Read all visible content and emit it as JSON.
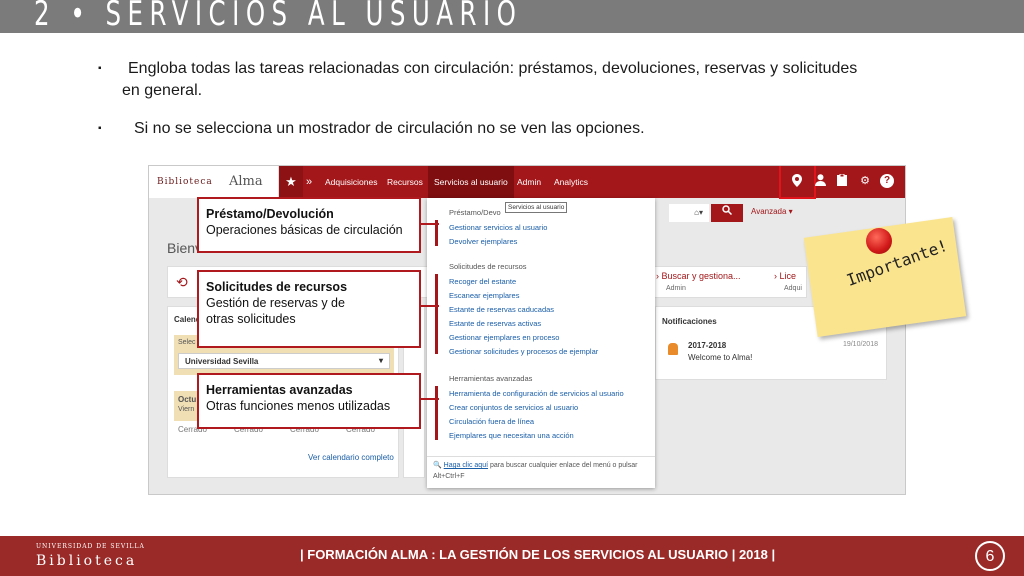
{
  "slide": {
    "title": "2 • SERVICIOS AL USUARIO",
    "bullet_mark": "▪",
    "bullets": [
      {
        "line1": "Engloba todas las tareas relacionadas con circulación: préstamos, devoluciones, reservas y solicitudes",
        "line2": "en general."
      },
      {
        "line1": "Si no se selecciona un mostrador de circulación no se ven las opciones."
      }
    ]
  },
  "alma": {
    "logo_text": "Biblioteca",
    "app_name": "Alma",
    "menu": [
      "Adquisiciones",
      "Recursos",
      "Servicios al usuario",
      "Admin",
      "Analytics"
    ],
    "active_menu_index": 2,
    "top_icons": [
      "location-icon",
      "user-icon",
      "tasks-icon",
      "gear-icon",
      "help-icon"
    ],
    "search_advanced": "Avanzada ▾",
    "welcome": "Bienv",
    "widget_items": [
      {
        "label": "Buscar y gestiona...",
        "sub": "Admin"
      },
      {
        "label": "Lice",
        "sub": "Adqui"
      }
    ],
    "calendar": {
      "header": "Calend",
      "select_label": "Selec",
      "select_value": "Universidad Sevilla",
      "month": "Octu",
      "month_sub": "Viern",
      "cells": [
        "Cerrado",
        "Cerrado",
        "Cerrado",
        "Cerrado"
      ],
      "link": "Ver calendario completo"
    },
    "notifications": {
      "header": "Notificaciones",
      "title": "2017-2018",
      "body": "Welcome to Alma!",
      "date": "19/10/2018"
    },
    "dropdown": {
      "tooltip": "Servicios al usuario",
      "sections": [
        {
          "title": "Préstamo/Devo",
          "links": [
            "Gestionar servicios al usuario",
            "Devolver ejemplares"
          ]
        },
        {
          "title": "Solicitudes de recursos",
          "links": [
            "Recoger del estante",
            "Escanear ejemplares",
            "Estante de reservas caducadas",
            "Estante de reservas activas",
            "Gestionar ejemplares en proceso",
            "Gestionar solicitudes y procesos de ejemplar"
          ]
        },
        {
          "title": "Herramientas avanzadas",
          "links": [
            "Herramienta de configuración de servicios al usuario",
            "Crear conjuntos de servicios al usuario",
            "Circulación fuera de línea",
            "Ejemplares que necesitan una acción"
          ]
        }
      ],
      "footer_link": "Haga clic aquí",
      "footer_text": "para buscar cualquier enlace del menú o pulsar Alt+Ctrl+F"
    }
  },
  "callouts": [
    {
      "title": "Préstamo/Devolución",
      "body": "Operaciones básicas de circulación"
    },
    {
      "title": "Solicitudes de recursos",
      "body1": "Gestión de reservas y de",
      "body2": "otras solicitudes"
    },
    {
      "title": "Herramientas avanzadas",
      "body": "Otras funciones menos utilizadas"
    }
  ],
  "sticky_note": "Importante!",
  "footer": {
    "logo_top": "UNIVERSIDAD DE SEVILLA",
    "logo": "Biblioteca",
    "text": "| FORMACIÓN ALMA :  LA GESTIÓN DE LOS SERVICIOS AL USUARIO | 2018 |",
    "page": "6"
  },
  "colors": {
    "accent": "#a3171a",
    "title_bar": "#7b7b7b",
    "footer": "#9a2a28",
    "link": "#1a5ea8",
    "sticky": "#fbe48e"
  }
}
